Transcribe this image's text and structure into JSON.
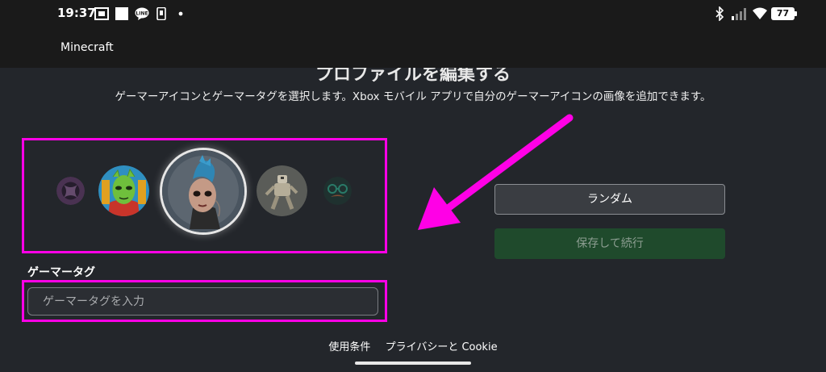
{
  "status_bar": {
    "time": "19:37",
    "battery": "77",
    "icons": [
      "notification-app-icon",
      "square-icon",
      "line-chat-icon",
      "phone-notification-icon",
      "dot-icon",
      "bluetooth-icon",
      "signal-icon",
      "wifi-icon",
      "battery-icon"
    ]
  },
  "app": {
    "title": "Minecraft"
  },
  "page": {
    "heading": "プロファイルを編集する",
    "subtitle": "ゲーマーアイコンとゲーマータグを選択します。Xbox モバイル アプリで自分のゲーマーアイコンの画像を追加できます。"
  },
  "gamerpics": [
    {
      "name": "xbox-logo-gamerpic",
      "selected": false
    },
    {
      "name": "green-alien-gamerpic",
      "selected": false
    },
    {
      "name": "blue-mohawk-punk-gamerpic",
      "selected": true
    },
    {
      "name": "robot-soldier-gamerpic",
      "selected": false
    },
    {
      "name": "glasses-mustache-gamerpic",
      "selected": false
    }
  ],
  "gamertag": {
    "label": "ゲーマータグ",
    "placeholder": "ゲーマータグを入力",
    "value": ""
  },
  "buttons": {
    "random": "ランダム",
    "save": "保存して続行"
  },
  "footer": {
    "terms": "使用条件",
    "privacy": "プライバシーと Cookie"
  },
  "colors": {
    "highlight": "#ff00e6",
    "background": "#23262b",
    "bar": "#1a1a1a",
    "save_button": "#1f4a2c"
  }
}
